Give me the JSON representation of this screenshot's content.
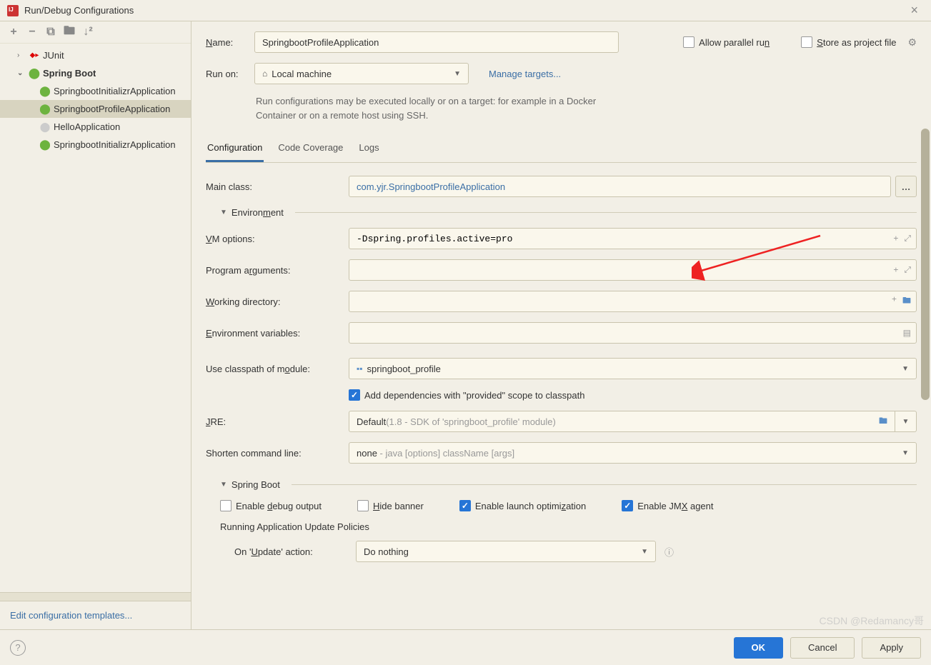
{
  "title": "Run/Debug Configurations",
  "sidebar": {
    "toolbar_items": [
      "add",
      "remove",
      "copy",
      "save",
      "sort"
    ],
    "tree": [
      {
        "label": "JUnit",
        "icon": "junit",
        "level": 1,
        "bold": false,
        "expanded": true,
        "chev": ">"
      },
      {
        "label": "Spring Boot",
        "icon": "spring",
        "level": 1,
        "bold": true,
        "expanded": true,
        "chev": "v"
      },
      {
        "label": "SpringbootInitializrApplication",
        "icon": "spring",
        "level": 2,
        "selected": false
      },
      {
        "label": "SpringbootProfileApplication",
        "icon": "spring",
        "level": 2,
        "selected": true
      },
      {
        "label": "HelloApplication",
        "icon": "spring-gray",
        "level": 2,
        "selected": false
      },
      {
        "label": "SpringbootInitializrApplication",
        "icon": "spring",
        "level": 2,
        "selected": false
      }
    ],
    "edit_templates": "Edit configuration templates..."
  },
  "form": {
    "name_label": "Name:",
    "name_value": "SpringbootProfileApplication",
    "allow_parallel": "Allow parallel run",
    "store_project": "Store as project file",
    "runon_label": "Run on:",
    "runon_value": "Local machine",
    "manage_targets": "Manage targets...",
    "runon_hint": "Run configurations may be executed locally or on a target: for example in a Docker Container or on a remote host using SSH."
  },
  "tabs": [
    "Configuration",
    "Code Coverage",
    "Logs"
  ],
  "config": {
    "main_class_label": "Main class:",
    "main_class_value": "com.yjr.SpringbootProfileApplication",
    "environment_section": "Environment",
    "vm_options_label": "VM options:",
    "vm_options_value": "-Dspring.profiles.active=pro",
    "program_args_label": "Program arguments:",
    "program_args_value": "",
    "working_dir_label": "Working directory:",
    "working_dir_value": "",
    "env_vars_label": "Environment variables:",
    "env_vars_value": "",
    "classpath_label": "Use classpath of module:",
    "classpath_value": "springboot_profile",
    "provided_scope": "Add dependencies with \"provided\" scope to classpath",
    "jre_label": "JRE:",
    "jre_value": "Default",
    "jre_hint": " (1.8 - SDK of 'springboot_profile' module)",
    "shorten_label": "Shorten command line:",
    "shorten_value": "none",
    "shorten_hint": " - java [options] className [args]",
    "springboot_section": "Spring Boot",
    "enable_debug": "Enable debug output",
    "hide_banner": "Hide banner",
    "enable_launch": "Enable launch optimization",
    "enable_jmx": "Enable JMX agent",
    "running_policies": "Running Application Update Policies",
    "on_update_label": "On 'Update' action:",
    "on_update_value": "Do nothing"
  },
  "buttons": {
    "ok": "OK",
    "cancel": "Cancel",
    "apply": "Apply"
  },
  "watermark": "CSDN @Redamancy哥"
}
